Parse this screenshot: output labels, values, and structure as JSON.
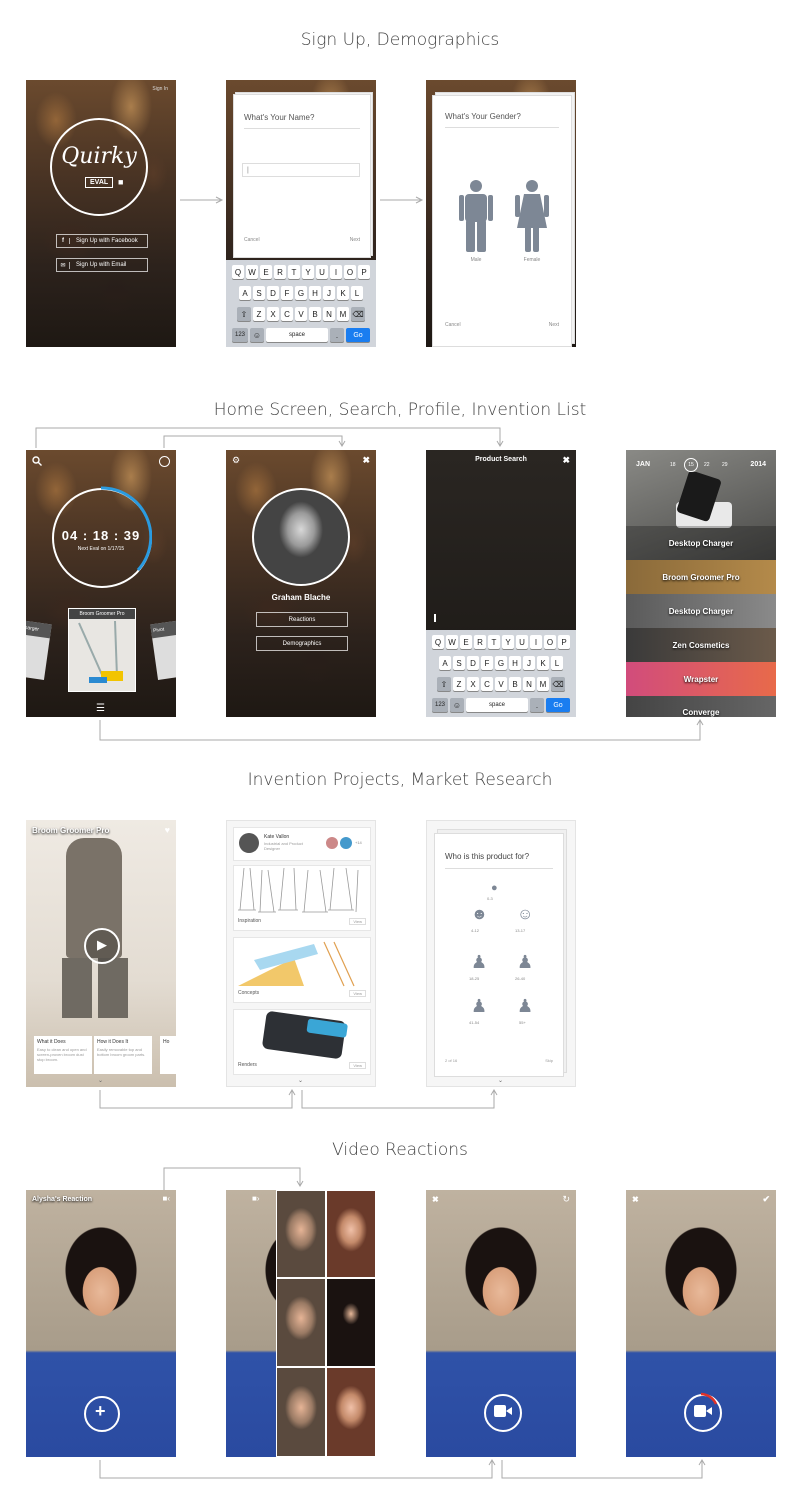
{
  "sections": {
    "signup": "Sign Up, Demographics",
    "home": "Home Screen, Search, Profile, Invention List",
    "projects": "Invention Projects, Market Research",
    "reactions": "Video Reactions"
  },
  "signup_screen": {
    "sign_in": "Sign In",
    "logo_text": "Quirky",
    "logo_badge": "EVAL",
    "facebook_btn": "Sign Up with Facebook",
    "email_btn": "Sign Up with Email"
  },
  "name_screen": {
    "question": "What's Your Name?",
    "input_value": "|",
    "cancel": "Cancel",
    "next": "Next"
  },
  "gender_screen": {
    "question": "What's Your Gender?",
    "male": "Male",
    "female": "Female",
    "cancel": "Cancel",
    "next": "Next"
  },
  "keyboard": {
    "row1": [
      "Q",
      "W",
      "E",
      "R",
      "T",
      "Y",
      "U",
      "I",
      "O",
      "P"
    ],
    "row2": [
      "A",
      "S",
      "D",
      "F",
      "G",
      "H",
      "J",
      "K",
      "L"
    ],
    "row3": [
      "Z",
      "X",
      "C",
      "V",
      "B",
      "N",
      "M"
    ],
    "num": "123",
    "space": "space",
    "dot": ".",
    "go": "Go"
  },
  "home_screen": {
    "timer": "04 : 18 : 39",
    "next_eval": "Next Eval on 1/17/15",
    "card_left": "Charger",
    "card_center": "Broom Groomer Pro",
    "card_right": "Pivot"
  },
  "profile_screen": {
    "name": "Graham Blache",
    "reactions": "Reactions",
    "demographics": "Demographics"
  },
  "search_screen": {
    "title": "Product Search"
  },
  "list_screen": {
    "month": "JAN",
    "days": [
      "18",
      "15",
      "22",
      "29"
    ],
    "year": "2014",
    "items": [
      "Desktop Charger",
      "Broom Groomer Pro",
      "Desktop Charger",
      "Zen Cosmetics",
      "Wrapster",
      "Converge"
    ]
  },
  "project_screen": {
    "title": "Broom Groomer Pro",
    "card1_title": "What it Does",
    "card1_text": "Easy to clean and open and screen-proven broom dust stop broom.",
    "card2_title": "How it Does It",
    "card2_text": "Easily removable top and bottom broom groom parts.",
    "card3_title": "Ho"
  },
  "research_screen": {
    "person_name": "Kate Vallon",
    "person_role": "Industrial and Product Designer",
    "count": "+14",
    "sections": [
      "Inspiration",
      "Concepts",
      "Renders"
    ],
    "view": "View"
  },
  "survey_screen": {
    "question": "Who is this product for?",
    "ages": [
      "0-3",
      "4-12",
      "13-17",
      "18-25",
      "26-40",
      "41-54",
      "55+"
    ],
    "progress": "2 of 16",
    "skip": "Skip"
  },
  "reaction_screen": {
    "title": "Alysha's Reaction"
  }
}
